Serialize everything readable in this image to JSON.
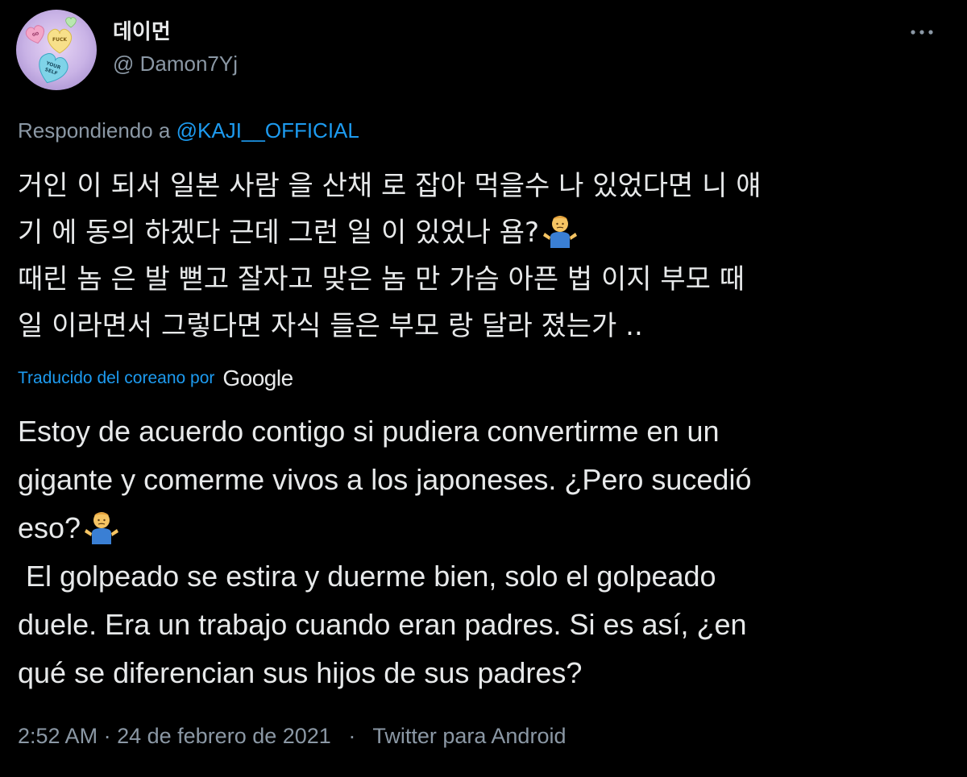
{
  "author": {
    "display_name": "데이먼",
    "handle": "@ Damon7Yj",
    "avatar_labels": [
      "GO",
      "FUCK",
      "YOUR",
      "SELF"
    ]
  },
  "reply": {
    "prefix": "Respondiendo a",
    "mention": "@KAJI__OFFICIAL"
  },
  "original_text": {
    "lines": [
      "거인 이 되서 일본 사람 을 산채 로 잡아 먹을수 나 있었다면 니 얘",
      "기 에 동의 하겠다 근데 그런 일 이 있었나 욤?",
      "때린 놈 은 발 뻗고 잘자고 맞은 놈 만 가슴 아픈 법 이지 부모 때",
      "일 이라면서 그렇다면 자식 들은 부모 랑 달라 졌는가 .."
    ]
  },
  "translation": {
    "label": "Traducido del coreano por",
    "provider": "Google"
  },
  "translated_text": {
    "lines": [
      "Estoy de acuerdo contigo si pudiera convertirme en un",
      "gigante y comerme vivos a los japoneses. ¿Pero sucedió",
      "eso?",
      " El golpeado se estira y duerme bien, solo el golpeado",
      "duele. Era un trabajo cuando eran padres. Si es así, ¿en",
      "qué se diferencian sus hijos de sus padres?"
    ]
  },
  "meta": {
    "time": "2:52 AM",
    "date": "24 de febrero de 2021",
    "separator": "·",
    "source": "Twitter para Android"
  },
  "icons": {
    "more": "more-horizontal-icon",
    "emoji": "person-shrugging-emoji"
  },
  "colors": {
    "background": "#000000",
    "text": "#e7e9ea",
    "secondary": "#8b98a5",
    "link": "#1d9bf0"
  }
}
